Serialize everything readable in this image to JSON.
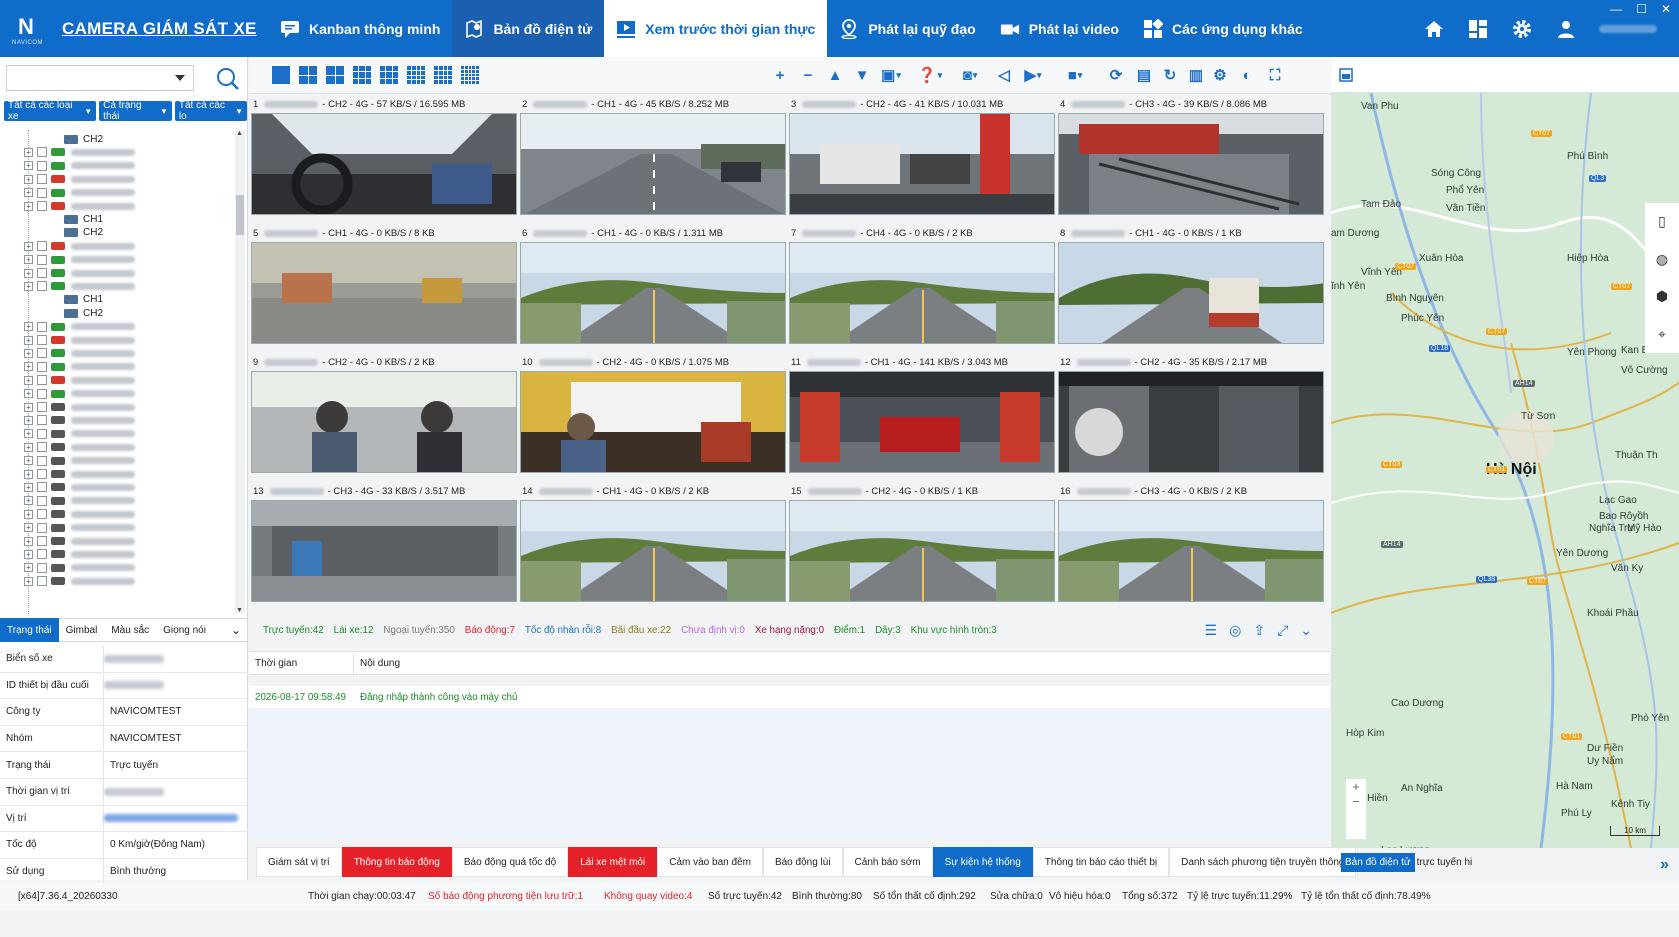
{
  "window": {
    "minimize": "—",
    "maximize": "☐",
    "close": "✕"
  },
  "brand": {
    "logo_letter": "N",
    "logo_sub": "NAVICOM",
    "title": "CAMERA GIÁM SÁT XE"
  },
  "nav": [
    {
      "label": "Kanban thông minh",
      "icon": "kanban-chat-icon"
    },
    {
      "label": "Bản đồ điện tử",
      "icon": "map-pin-icon"
    },
    {
      "label": "Xem trước thời gian thực",
      "icon": "play-screen-icon"
    },
    {
      "label": "Phát lại quỹ đạo",
      "icon": "location-icon"
    },
    {
      "label": "Phát lại video",
      "icon": "video-camera-icon"
    },
    {
      "label": "Các ứng dụng khác",
      "icon": "apps-grid-icon"
    }
  ],
  "header_icons": [
    "home-icon",
    "dashboard-icon",
    "settings-gear-icon",
    "user-icon"
  ],
  "filters": {
    "vehicle_type": "Tất cả các loại xe",
    "status": "Cả trạng thái",
    "all_levels": "Tất cả các lo"
  },
  "tree": [
    {
      "kind": "channel",
      "label": "CH2"
    },
    {
      "kind": "vehicle",
      "color": "#2e9a3a"
    },
    {
      "kind": "vehicle",
      "color": "#2e9a3a"
    },
    {
      "kind": "vehicle",
      "color": "#d33a2c"
    },
    {
      "kind": "vehicle",
      "color": "#2e9a3a"
    },
    {
      "kind": "vehicle",
      "color": "#d33a2c"
    },
    {
      "kind": "channel",
      "label": "CH1"
    },
    {
      "kind": "channel",
      "label": "CH2"
    },
    {
      "kind": "vehicle",
      "color": "#d33a2c"
    },
    {
      "kind": "vehicle",
      "color": "#2e9a3a"
    },
    {
      "kind": "vehicle",
      "color": "#2e9a3a"
    },
    {
      "kind": "vehicle",
      "color": "#2e9a3a"
    },
    {
      "kind": "channel",
      "label": "CH1"
    },
    {
      "kind": "channel",
      "label": "CH2"
    },
    {
      "kind": "vehicle",
      "color": "#2e9a3a"
    },
    {
      "kind": "vehicle",
      "color": "#d33a2c"
    },
    {
      "kind": "vehicle",
      "color": "#2e9a3a"
    },
    {
      "kind": "vehicle",
      "color": "#2e9a3a"
    },
    {
      "kind": "vehicle",
      "color": "#d33a2c"
    },
    {
      "kind": "vehicle",
      "color": "#2e9a3a"
    },
    {
      "kind": "vehicle",
      "color": "#555555"
    },
    {
      "kind": "vehicle",
      "color": "#555555"
    },
    {
      "kind": "vehicle",
      "color": "#555555"
    },
    {
      "kind": "vehicle",
      "color": "#555555"
    },
    {
      "kind": "vehicle",
      "color": "#555555"
    },
    {
      "kind": "vehicle",
      "color": "#555555"
    },
    {
      "kind": "vehicle",
      "color": "#555555"
    },
    {
      "kind": "vehicle",
      "color": "#555555"
    },
    {
      "kind": "vehicle",
      "color": "#555555"
    },
    {
      "kind": "vehicle",
      "color": "#555555"
    },
    {
      "kind": "vehicle",
      "color": "#555555"
    },
    {
      "kind": "vehicle",
      "color": "#555555"
    },
    {
      "kind": "vehicle",
      "color": "#555555"
    },
    {
      "kind": "vehicle",
      "color": "#555555"
    }
  ],
  "left_tabs": [
    "Trạng thái",
    "Gimbal",
    "Màu sắc",
    "Giọng nói"
  ],
  "properties": [
    {
      "key": "Biển số xe",
      "value": "",
      "style": "blurred"
    },
    {
      "key": "ID thiết bị đầu cuối",
      "value": "",
      "style": "blurred"
    },
    {
      "key": "Công ty",
      "value": "NAVICOMTEST",
      "style": ""
    },
    {
      "key": "Nhóm",
      "value": "NAVICOMTEST",
      "style": ""
    },
    {
      "key": "Trạng thái",
      "value": "Trực tuyến",
      "style": ""
    },
    {
      "key": "Thời gian vị trí",
      "value": "",
      "style": "blurred"
    },
    {
      "key": "Vị trí",
      "value": "",
      "style": "link"
    },
    {
      "key": "Tốc độ",
      "value": "0 Km/giờ(Đông Nam)",
      "style": ""
    },
    {
      "key": "Sử dụng",
      "value": "Bình thường",
      "style": ""
    }
  ],
  "toolbar_icons": [
    "zoom-in-icon",
    "zoom-out-icon",
    "tilt-up-icon",
    "tilt-down-icon",
    "layout-dropdown-icon",
    "help-dropdown-icon",
    "snapshot-dropdown-icon",
    "mute-icon",
    "play-dropdown-icon",
    "stop-dropdown-icon",
    "refresh-icon",
    "save-icon",
    "loop-icon",
    "delete-icon",
    "settings-icon",
    "intercom-icon",
    "fullscreen-icon"
  ],
  "tiles": [
    {
      "num": "1",
      "info": "- CH2 - 4G - 57 KB/S / 16.595 MB",
      "scene": "cabin"
    },
    {
      "num": "2",
      "info": "- CH1 - 4G - 45 KB/S / 8.252 MB",
      "scene": "highway"
    },
    {
      "num": "3",
      "info": "- CH2 - 4G - 41 KB/S / 10.031 MB",
      "scene": "traffic"
    },
    {
      "num": "4",
      "info": "- CH3 - 4G - 39 KB/S / 8.086 MB",
      "scene": "cargo"
    },
    {
      "num": "5",
      "info": "- CH1 - 4G - 0 KB/S / 8 KB",
      "scene": "blurroad"
    },
    {
      "num": "6",
      "info": "- CH1 - 4G - 0 KB/S / 1.311 MB",
      "scene": "road"
    },
    {
      "num": "7",
      "info": "- CH4 - 4G - 0 KB/S / 2 KB",
      "scene": "road"
    },
    {
      "num": "8",
      "info": "- CH1 - 4G - 0 KB/S / 1 KB",
      "scene": "truckroad"
    },
    {
      "num": "9",
      "info": "- CH2 - 4G - 0 KB/S / 2 KB",
      "scene": "drivers"
    },
    {
      "num": "10",
      "info": "- CH2 - 4G - 0 KB/S / 1.075 MB",
      "scene": "yellowcab"
    },
    {
      "num": "11",
      "info": "- CH1 - 4G - 141 KB/S / 3.043 MB",
      "scene": "garage"
    },
    {
      "num": "12",
      "info": "- CH2 - 4G - 35 KB/S / 2.17 MB",
      "scene": "seats"
    },
    {
      "num": "13",
      "info": "- CH3 - 4G - 33 KB/S / 3.517 MB",
      "scene": "warehouse"
    },
    {
      "num": "14",
      "info": "- CH1 - 4G - 0 KB/S / 2 KB",
      "scene": "road"
    },
    {
      "num": "15",
      "info": "- CH2 - 4G - 0 KB/S / 1 KB",
      "scene": "road"
    },
    {
      "num": "16",
      "info": "- CH3 - 4G - 0 KB/S / 2 KB",
      "scene": "road"
    }
  ],
  "stats": [
    {
      "text": "Trực tuyến:42",
      "color": "#1f8a2a"
    },
    {
      "text": "Lái xe:12",
      "color": "#1f8a2a"
    },
    {
      "text": "Ngoại tuyến:350",
      "color": "#777777"
    },
    {
      "text": "Báo động:7",
      "color": "#e62129"
    },
    {
      "text": "Tốc độ nhàn rỗi:8",
      "color": "#1c6fc9"
    },
    {
      "text": "Bãi đầu xe:22",
      "color": "#8a7a1a"
    },
    {
      "text": "Chưa định vị:0",
      "color": "#b36ad8"
    },
    {
      "text": "Xe hạng nặng:0",
      "color": "#a0153a"
    },
    {
      "text": "Điểm:1",
      "color": "#1f8a2a"
    },
    {
      "text": "Dây:3",
      "color": "#1f8a2a"
    },
    {
      "text": "Khu vực hình tròn:3",
      "color": "#1f8a2a"
    }
  ],
  "log": {
    "col_time": "Thời gian",
    "col_content": "Nội dung",
    "time": "2026-08-17 09:58:49",
    "content": "Đăng nhập thành công vào máy chủ"
  },
  "bottom_tabs": [
    {
      "label": "Giám sát vị trí",
      "style": ""
    },
    {
      "label": "Thông tin báo động",
      "style": "red"
    },
    {
      "label": "Báo động quá tốc độ",
      "style": ""
    },
    {
      "label": "Lái xe mệt mỏi",
      "style": "red"
    },
    {
      "label": "Cảm vào ban đêm",
      "style": ""
    },
    {
      "label": "Báo động lùi",
      "style": ""
    },
    {
      "label": "Cảnh báo sớm",
      "style": ""
    },
    {
      "label": "Sự kiện hệ thống",
      "style": "blue"
    },
    {
      "label": "Thông tin báo cáo thiết bị",
      "style": ""
    },
    {
      "label": "Danh sách phương tiện truyền thông",
      "style": ""
    }
  ],
  "map_bottom": {
    "tag": "Bản đồ điện tử",
    "rest": "trực tuyến hi"
  },
  "footer": {
    "version": "[x64]7.36.4_20260330",
    "runtime": "Thời gian chạy:00:03:47",
    "alarm_storage": "Số báo động phương tiện lưu trữ:1",
    "no_video": "Không quay video:4",
    "online": "Số trực tuyến:42",
    "normal": "Bình thường:80",
    "fixed_loss": "Số tổn thất cố định:292",
    "repair": "Sửa chữa:0",
    "disabled": "Vô hiệu hóa:0",
    "total": "Tổng số:372",
    "online_rate": "Tỷ lệ trực tuyến:11.29%",
    "loss_rate": "Tỷ lệ tổn thất cố định:78.49%"
  },
  "map": {
    "labels": [
      "Van Phu",
      "Phú Bình",
      "Sóng Công",
      "Phổ Yên",
      "Tam Đảo",
      "Vân Tiền",
      "am Dương",
      "Xuân Hòa",
      "Hiệp Hòa",
      "Vĩnh Yên",
      "ĩnh Yên",
      "Bình Nguyên",
      "Phúc Yên",
      "Yên Phong",
      "Kan Bào",
      "Võ Cường",
      "Từ Sơn",
      "Hà Nội",
      "Thuận Th",
      "Lạc Gao",
      "Bao Rôyồh",
      "Nghĩa Trụ",
      "Mỹ Hào",
      "Yên Dương",
      "Văn Ky",
      "Khoái Phầu",
      "Cao Dương",
      "Phò Yên",
      "Hòp Kim",
      "Dư Fiền",
      "Uy Nẩm",
      "Hà Nam",
      "An Nghĩa",
      "Phú Ly",
      "Kênh Tiy",
      "Dân Hiền",
      "Lạc Lương"
    ],
    "scale": "10 km"
  }
}
